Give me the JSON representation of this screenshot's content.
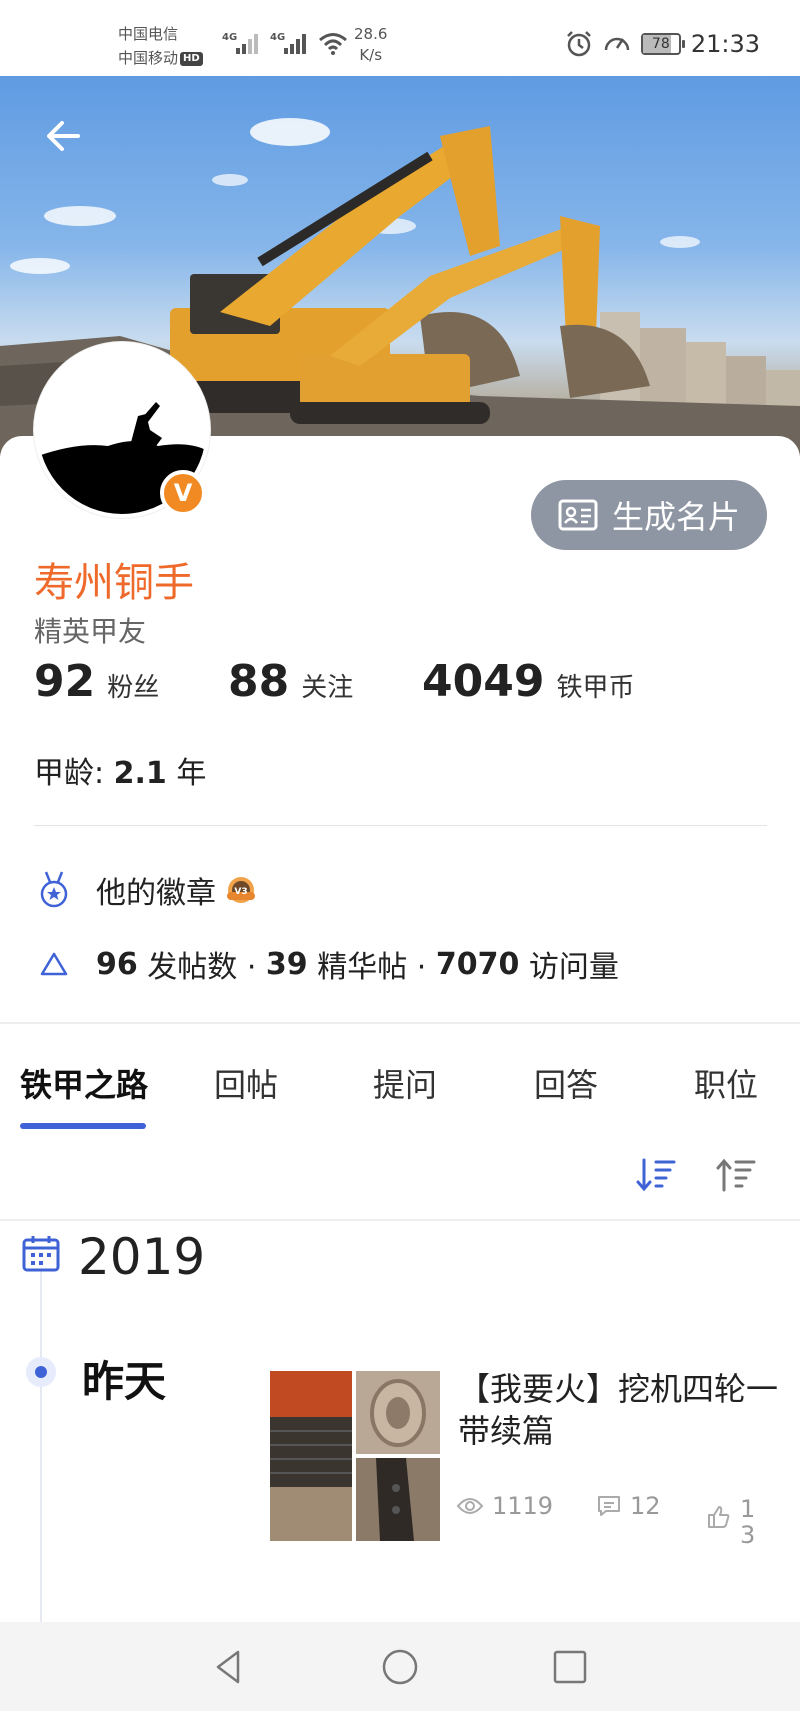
{
  "status_bar": {
    "carrier_1": "中国电信",
    "carrier_2": "中国移动",
    "hd": "HD",
    "net_type": "4G",
    "speed_value": "28.6",
    "speed_unit": "K/s",
    "battery": "78",
    "time": "21:33"
  },
  "profile": {
    "name": "寿州铜手",
    "title": "精英甲友",
    "generate_card_label": "生成名片",
    "verified_badge": "V",
    "stats": [
      {
        "value": "92",
        "label": "粉丝"
      },
      {
        "value": "88",
        "label": "关注"
      },
      {
        "value": "4049",
        "label": "铁甲币"
      }
    ],
    "age_label": "甲龄:",
    "age_value": "2.1",
    "age_unit": "年",
    "badges_label": "他的徽章",
    "badge_level": "V3",
    "posts_count": "96",
    "posts_label": "发帖数 ·",
    "featured_count": "39",
    "featured_label": "精华帖 ·",
    "visits_count": "7070",
    "visits_label": "访问量"
  },
  "tabs": [
    {
      "label": "铁甲之路",
      "active": true
    },
    {
      "label": "回帖",
      "active": false
    },
    {
      "label": "提问",
      "active": false
    },
    {
      "label": "回答",
      "active": false
    },
    {
      "label": "职位",
      "active": false
    }
  ],
  "timeline": {
    "year": "2019",
    "day": "昨天",
    "post": {
      "title": "【我要火】挖机四轮一带续篇",
      "views": "1119",
      "comments": "12",
      "likes_line1": "1",
      "likes_line2": "3"
    }
  },
  "icons": {
    "back": "arrow-left-icon",
    "card": "id-card-icon",
    "medal": "medal-icon",
    "triangle": "triangle-icon",
    "sort_desc": "sort-desc-icon",
    "sort_asc": "sort-asc-icon",
    "calendar": "calendar-icon",
    "eye": "eye-icon",
    "comment": "comment-icon",
    "like": "thumbs-up-icon"
  },
  "colors": {
    "accent": "#3f63d6",
    "username": "#ef6a2a",
    "badge_orange": "#f28a24",
    "card_button": "#8f96a3"
  }
}
